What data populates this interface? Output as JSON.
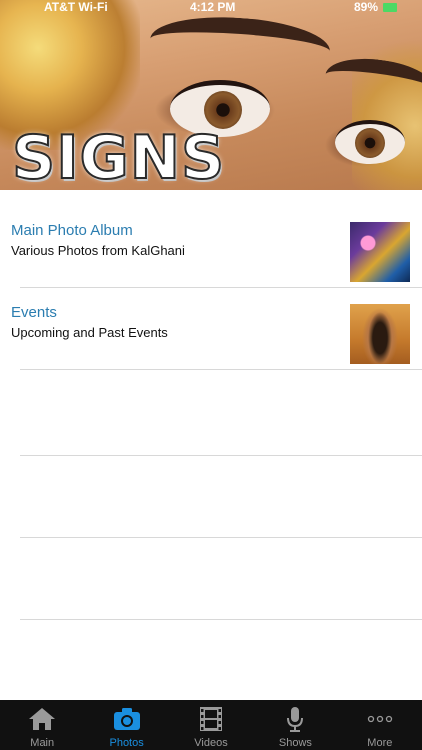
{
  "status_bar": {
    "carrier": "AT&T Wi-Fi",
    "time": "4:12 PM",
    "battery_percent": "89%",
    "battery_color": "#4cd964"
  },
  "header": {
    "logo_text": "SIGNS"
  },
  "list": [
    {
      "title": "Main Photo Album",
      "subtitle": "Various Photos from KalGhani",
      "thumbnail": "album-artwork"
    },
    {
      "title": "Events",
      "subtitle": "Upcoming and Past Events",
      "thumbnail": "event-photo"
    }
  ],
  "tabbar": {
    "active_color": "#1a8fe0",
    "tabs": [
      {
        "label": "Main",
        "icon": "home-icon",
        "active": false
      },
      {
        "label": "Photos",
        "icon": "camera-icon",
        "active": true
      },
      {
        "label": "Videos",
        "icon": "film-icon",
        "active": false
      },
      {
        "label": "Shows",
        "icon": "microphone-icon",
        "active": false
      },
      {
        "label": "More",
        "icon": "more-icon",
        "active": false
      }
    ]
  },
  "colors": {
    "link_title": "#2b7db0",
    "tabbar_bg": "#111111"
  }
}
